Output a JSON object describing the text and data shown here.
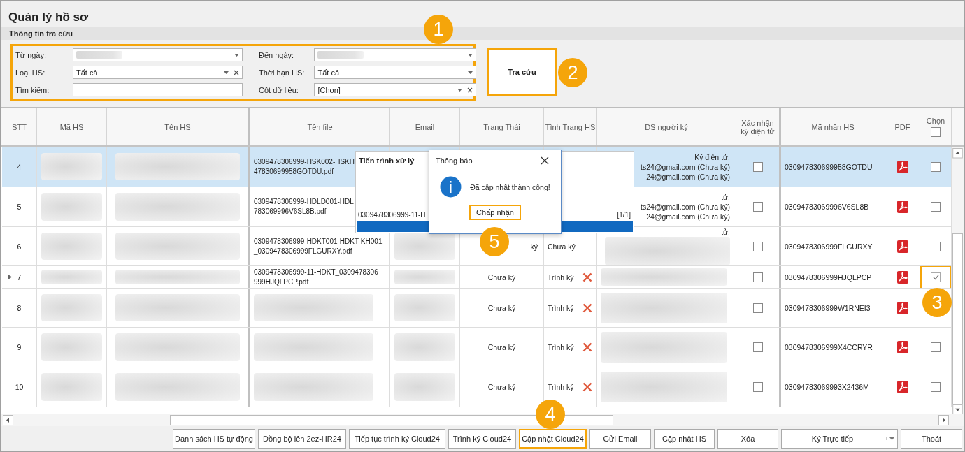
{
  "window": {
    "title": "Quản lý hồ sơ"
  },
  "search_panel": {
    "title": "Thông tin tra cứu",
    "highlighted": true,
    "fields": [
      {
        "label": "Từ ngày:",
        "kind": "date",
        "blurred": true
      },
      {
        "label": "Đến ngày:",
        "kind": "date",
        "blurred": true
      },
      {
        "label": "Loại HS:",
        "kind": "combo_clear",
        "value": "Tất cả"
      },
      {
        "label": "Thời hạn HS:",
        "kind": "combo",
        "value": "Tất cả"
      },
      {
        "label": "Tìm kiếm:",
        "kind": "text"
      },
      {
        "label": "Cột dữ liệu:",
        "kind": "combo_clear",
        "value": "[Chọn]"
      }
    ],
    "search_button": {
      "label": "Tra cứu",
      "highlighted": true
    }
  },
  "table": {
    "columns": [
      "STT",
      "Mã HS",
      "Tên HS",
      "Tên file",
      "Email",
      "Trạng Thái",
      "Tình Trạng HS",
      "DS người ký",
      "Xác nhận ký điện tử",
      "Mã nhận HS",
      "PDF",
      "Chọn"
    ],
    "select_all_checked": false,
    "rows": [
      {
        "stt": "4",
        "selected": true,
        "current": false,
        "ma_hs_blurred": true,
        "ten_hs_blurred": true,
        "file": {
          "lines": [
            "0309478306999-HSK002-HSKH",
            "47830699958GOTDU.pdf"
          ]
        },
        "signers": {
          "lines": [
            "Ký điện tử:",
            "ts24@gmail.com (Chưa ký)",
            "24@gmail.com (Chưa ký)"
          ],
          "covered": true,
          "blurred": false
        },
        "confirmed": false,
        "code": "030947830699958GOTDU",
        "checked": false,
        "highlighted": false
      },
      {
        "stt": "5",
        "selected": false,
        "current": false,
        "ma_hs_blurred": true,
        "ten_hs_blurred": true,
        "file": {
          "lines": [
            "0309478306999-HDLD001-HDL",
            "783069996V6SL8B.pdf"
          ]
        },
        "signers": {
          "lines": [
            "tử:",
            "ts24@gmail.com (Chưa ký)",
            "24@gmail.com (Chưa ký)"
          ],
          "covered": true,
          "blurred": false
        },
        "confirmed": false,
        "code": "03094783069996V6SL8B",
        "checked": false,
        "highlighted": false
      },
      {
        "stt": "6",
        "selected": false,
        "current": false,
        "ma_hs_blurred": true,
        "ten_hs_blurred": true,
        "file": {
          "lines": [
            "0309478306999-HDKT001-HDKT-KH001",
            "_0309478306999FLGURXY.pdf"
          ]
        },
        "email_blurred": true,
        "status": {
          "text": "ký",
          "covered": true
        },
        "state": {
          "text": "Chưa ký",
          "x_mark": false
        },
        "signers": {
          "lines": [
            "tử:"
          ],
          "covered": true,
          "blurred": true
        },
        "confirmed": false,
        "code": "0309478306999FLGURXY",
        "checked": false,
        "highlighted": false
      },
      {
        "stt": "7",
        "selected": false,
        "current": true,
        "ma_hs_blurred": true,
        "ten_hs_blurred": true,
        "file": {
          "lines": [
            "0309478306999-11-HDKT_0309478306",
            "999HJQLPCP.pdf"
          ]
        },
        "email_blurred": true,
        "status": {
          "text": "Chưa ký",
          "covered": false
        },
        "state": {
          "text": "Trình ký",
          "x_mark": true
        },
        "signers": {
          "blurred": true
        },
        "confirmed": false,
        "code": "0309478306999HJQLPCP",
        "checked": true,
        "highlighted": true
      },
      {
        "stt": "8",
        "selected": false,
        "current": false,
        "ma_hs_blurred": true,
        "ten_hs_blurred": true,
        "file_blurred": true,
        "email_blurred": true,
        "status": {
          "text": "Chưa ký",
          "covered": false
        },
        "state": {
          "text": "Trình ký",
          "x_mark": true
        },
        "signers": {
          "blurred": true
        },
        "confirmed": false,
        "code": "0309478306999W1RNEI3"
      },
      {
        "stt": "9",
        "selected": false,
        "current": false,
        "ma_hs_blurred": true,
        "ten_hs_blurred": true,
        "file_blurred": true,
        "email_blurred": true,
        "status": {
          "text": "Chưa ký",
          "covered": false
        },
        "state": {
          "text": "Trình ký",
          "x_mark": true
        },
        "signers": {
          "blurred": true
        },
        "confirmed": false,
        "code": "0309478306999X4CCRYR",
        "checked": false,
        "highlighted": false
      },
      {
        "stt": "10",
        "selected": false,
        "current": false,
        "ma_hs_blurred": true,
        "ten_hs_blurred": true,
        "file_blurred": true,
        "email_blurred": true,
        "status": {
          "text": "Chưa ký",
          "covered": false
        },
        "state": {
          "text": "Trình ký",
          "x_mark": true
        },
        "signers": {
          "blurred": true
        },
        "confirmed": false,
        "code": "03094783069993X2436M",
        "checked": false,
        "highlighted": false
      }
    ]
  },
  "progress_dialog": {
    "title": "Tiến trình xử lý",
    "item": "0309478306999-11-H",
    "counter": "[1/1]",
    "level": 1
  },
  "message_box": {
    "title": "Thông báo",
    "message": "Đã cập nhật thành công!",
    "button": {
      "label": "Chấp nhận",
      "highlighted": true
    }
  },
  "buttons": [
    {
      "label": "Danh sách HS tự động",
      "kind": "plain",
      "highlighted": false
    },
    {
      "label": "Đồng bộ lên 2ez-HR24",
      "kind": "plain",
      "highlighted": false
    },
    {
      "label": "Tiếp tục trình ký Cloud24",
      "kind": "plain",
      "highlighted": false
    },
    {
      "label": "Trình ký Cloud24",
      "kind": "plain",
      "highlighted": false
    },
    {
      "label": "Cập nhật Cloud24",
      "kind": "plain",
      "highlighted": true
    },
    {
      "label": "Gửi Email",
      "kind": "plain",
      "highlighted": false
    },
    {
      "label": "Cập nhật HS",
      "kind": "plain",
      "highlighted": false
    },
    {
      "label": "Xóa",
      "kind": "plain",
      "highlighted": false
    },
    {
      "label": "Ký Trực tiếp",
      "kind": "split",
      "highlighted": false
    },
    {
      "label": "Thoát",
      "kind": "plain",
      "highlighted": false
    }
  ],
  "callouts": [
    "1",
    "2",
    "3",
    "4",
    "5"
  ]
}
